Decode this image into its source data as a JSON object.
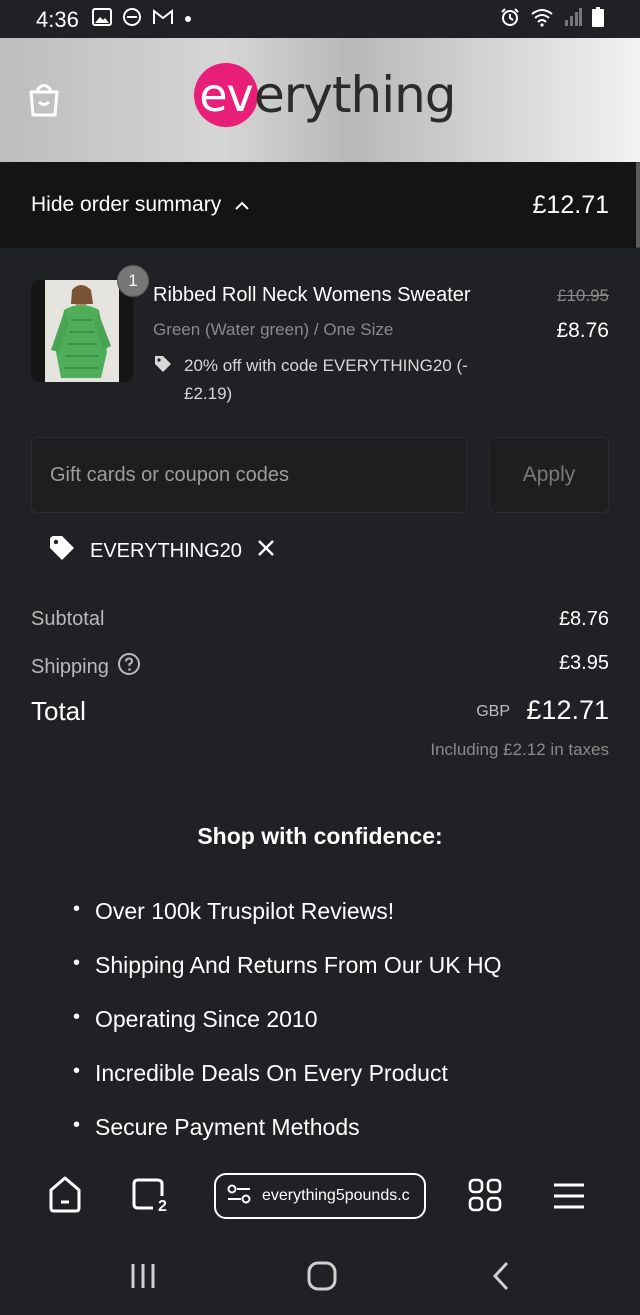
{
  "status_bar": {
    "time": "4:36"
  },
  "header": {
    "logo_ev": "ev",
    "logo_rest": "erything"
  },
  "summary": {
    "toggle_label": "Hide order summary",
    "total": "£12.71"
  },
  "product": {
    "quantity": "1",
    "name": "Ribbed Roll Neck Womens Sweater",
    "variant": "Green (Water green) / One Size",
    "discount_text": "20% off with code EVERYTHING20 (-£2.19)",
    "original_price": "£10.95",
    "price": "£8.76"
  },
  "coupon": {
    "placeholder": "Gift cards or coupon codes",
    "apply_label": "Apply",
    "applied_code": "EVERYTHING20"
  },
  "totals": {
    "subtotal_label": "Subtotal",
    "subtotal_value": "£8.76",
    "shipping_label": "Shipping",
    "shipping_value": "£3.95",
    "total_label": "Total",
    "currency": "GBP",
    "total_value": "£12.71",
    "taxes_note": "Including £2.12 in taxes"
  },
  "confidence": {
    "title": "Shop with confidence:",
    "items": [
      "Over 100k Truspilot Reviews!",
      "Shipping And Returns From Our UK HQ",
      "Operating Since 2010",
      "Incredible Deals On Every Product",
      "Secure Payment Methods"
    ]
  },
  "browser": {
    "url": "everything5pounds.c",
    "tab_count": "2"
  },
  "colors": {
    "brand_pink": "#e91e79",
    "background": "#202124"
  }
}
